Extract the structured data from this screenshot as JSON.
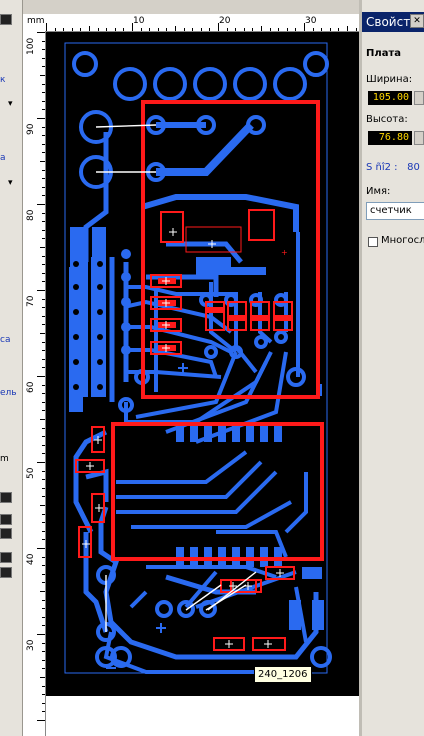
{
  "ruler": {
    "unit": "mm",
    "top_ticks": [
      "10",
      "20",
      "30"
    ],
    "left_ticks": [
      "100",
      "90",
      "80",
      "70",
      "60",
      "50",
      "40",
      "30"
    ]
  },
  "left_panel": {
    "fragments": [
      "к",
      "а",
      "са",
      "ель",
      "m"
    ]
  },
  "properties_panel": {
    "title": "Свойст",
    "section": "Плата",
    "width_label": "Ширина:",
    "width_value": "105.00",
    "height_label": "Высота:",
    "height_value": "76.80",
    "area_label": "S ñî2 :",
    "area_value": "80",
    "name_label": "Имя:",
    "name_value": "счетчик",
    "multilayer_label": "Многосл"
  },
  "tooltip": "240_1206",
  "colors": {
    "board": "#000000",
    "copper": "#2a6af0",
    "silkscreen": "#ff1a1a",
    "panel_title_bg": "#0a246a",
    "value_text": "#ffd800"
  }
}
